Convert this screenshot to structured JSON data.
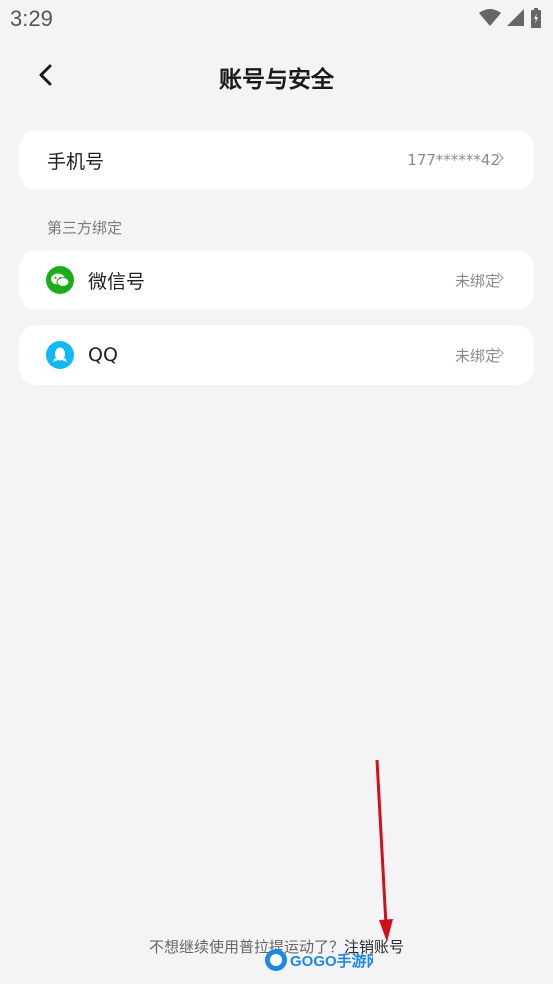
{
  "status_bar": {
    "time": "3:29"
  },
  "header": {
    "title": "账号与安全"
  },
  "phone": {
    "label": "手机号",
    "value": "177******42"
  },
  "third_party": {
    "section_label": "第三方绑定",
    "items": [
      {
        "label": "微信号",
        "status": "未绑定",
        "icon": "wechat-icon",
        "color": "#1aad19"
      },
      {
        "label": "QQ",
        "status": "未绑定",
        "icon": "qq-icon",
        "color": "#12b7f5"
      }
    ]
  },
  "footer": {
    "prompt": "不想继续使用普拉提运动了？",
    "link": "注销账号"
  },
  "watermark": {
    "text": "GOGO手游网"
  },
  "colors": {
    "background": "#f4f4f6",
    "card": "#ffffff",
    "arrow": "#d0101a"
  }
}
